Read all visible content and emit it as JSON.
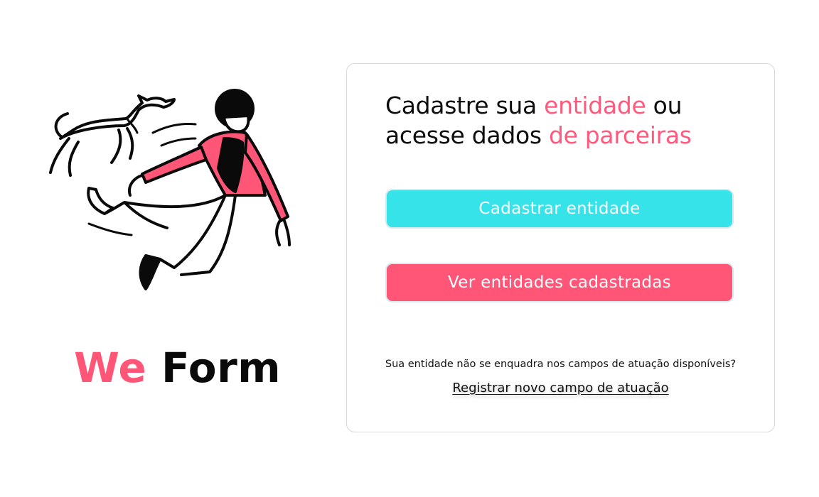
{
  "brand": {
    "accent_word": "We",
    "plain_word": "Form",
    "accent_color": "#ff5577"
  },
  "illustration": {
    "description_icon": "person-jumping-with-dog-illustration"
  },
  "card": {
    "heading_part1": "Cadastre sua ",
    "heading_highlight1": "entidade",
    "heading_part2": " ou acesse dados ",
    "heading_highlight2": "de parceiras",
    "primary_button_label": "Cadastrar entidade",
    "primary_button_color": "#36e3e8",
    "secondary_button_label": "Ver entidades cadastradas",
    "secondary_button_color": "#ff5577",
    "note_text": "Sua entidade não se enquadra nos campos de atuação disponíveis?",
    "register_link_label": "Registrar novo campo de atuação"
  }
}
